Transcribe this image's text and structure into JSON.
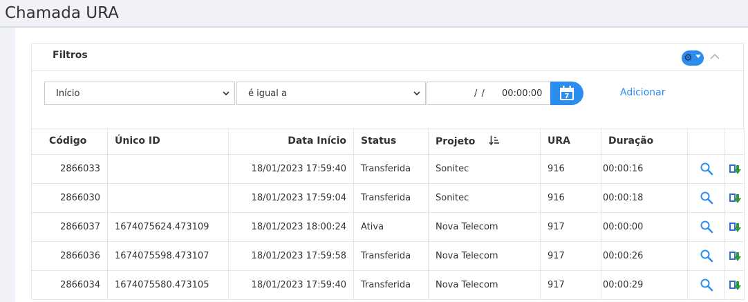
{
  "page": {
    "title": "Chamada URA"
  },
  "filters": {
    "title": "Filtros",
    "field_select": "Início",
    "operator_select": "é igual a",
    "date_placeholder": "/ /",
    "time_value": "00:00:00",
    "calendar_day": "7",
    "add_label": "Adicionar"
  },
  "table": {
    "columns": [
      "Código",
      "Único ID",
      "Data Início",
      "Status",
      "Projeto",
      "URA",
      "Duração"
    ],
    "rows": [
      {
        "codigo": "2866033",
        "unico_id": "",
        "data_inicio": "18/01/2023 17:59:40",
        "status": "Transferida",
        "projeto": "Sonitec",
        "ura": "916",
        "duracao": "00:00:16"
      },
      {
        "codigo": "2866030",
        "unico_id": "",
        "data_inicio": "18/01/2023 17:59:04",
        "status": "Transferida",
        "projeto": "Sonitec",
        "ura": "916",
        "duracao": "00:00:18"
      },
      {
        "codigo": "2866037",
        "unico_id": "1674075624.473109",
        "data_inicio": "18/01/2023 18:00:24",
        "status": "Ativa",
        "projeto": "Nova Telecom",
        "ura": "917",
        "duracao": "00:00:00"
      },
      {
        "codigo": "2866036",
        "unico_id": "1674075598.473107",
        "data_inicio": "18/01/2023 17:59:58",
        "status": "Transferida",
        "projeto": "Nova Telecom",
        "ura": "917",
        "duracao": "00:00:26"
      },
      {
        "codigo": "2866034",
        "unico_id": "1674075580.473105",
        "data_inicio": "18/01/2023 17:59:40",
        "status": "Transferida",
        "projeto": "Nova Telecom",
        "ura": "917",
        "duracao": "00:00:29"
      }
    ]
  },
  "icons": {
    "view": "magnifier-icon",
    "download": "download-icon",
    "settings": "gear-icon",
    "collapse": "chevron-up-icon",
    "sort": "sort-icon",
    "calendar": "calendar-icon"
  },
  "colors": {
    "accent": "#2c8df0",
    "download_green": "#2e9b3a"
  }
}
